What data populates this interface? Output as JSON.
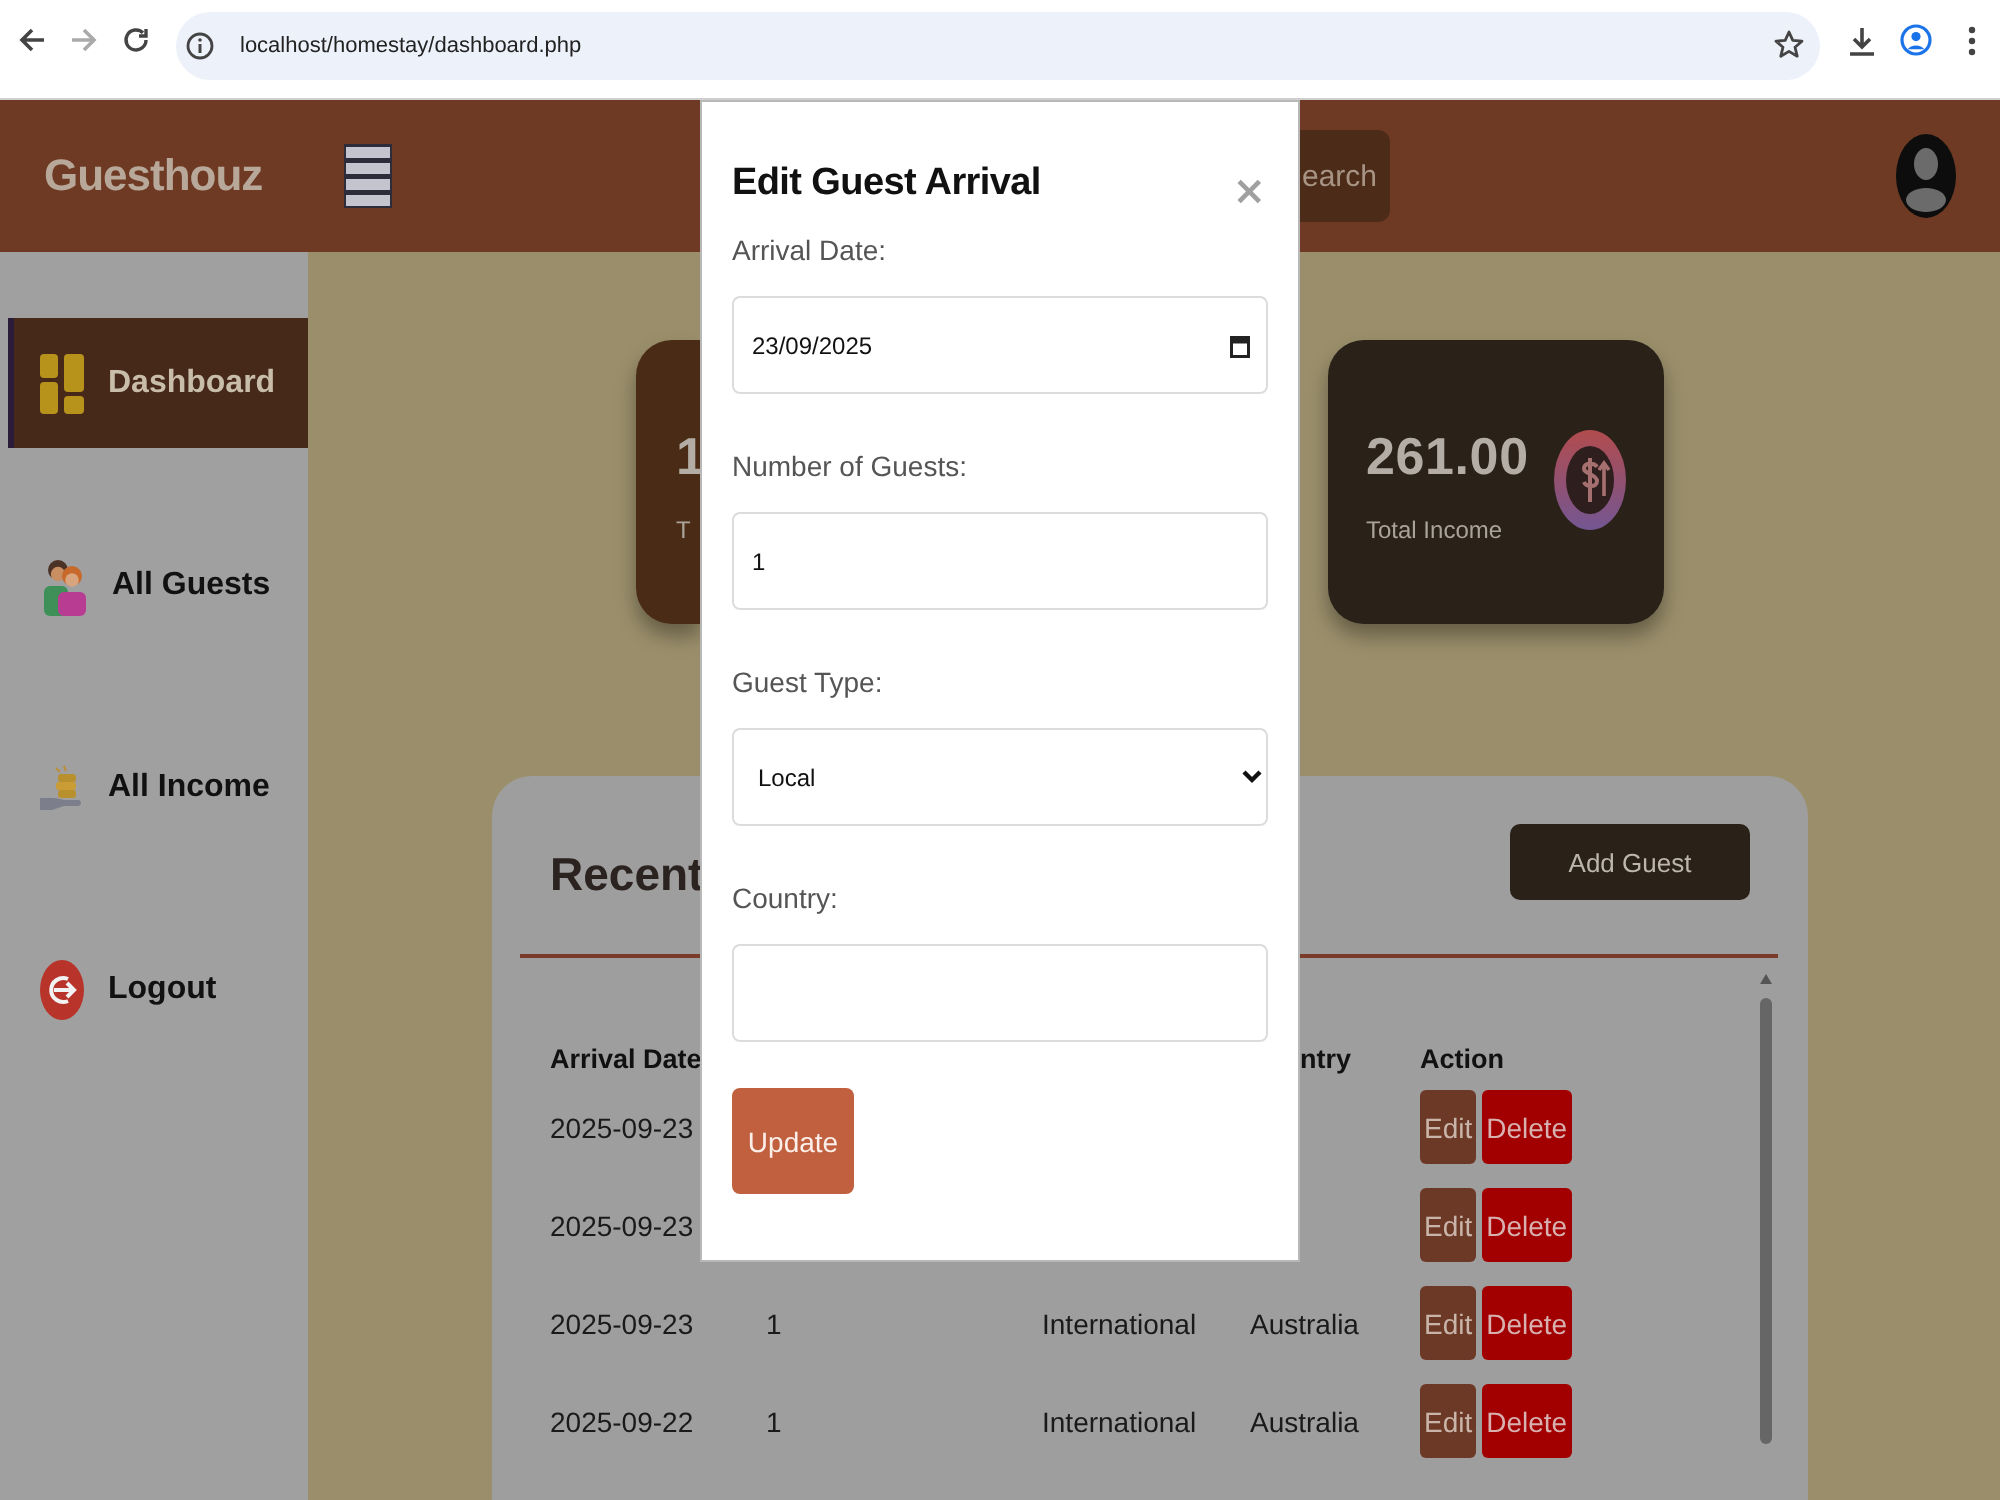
{
  "browser": {
    "url": "localhost/homestay/dashboard.php"
  },
  "header": {
    "logo": "Guesthouz",
    "search_button": "earch"
  },
  "sidebar": {
    "items": [
      {
        "label": "Dashboard",
        "selected": true
      },
      {
        "label": "All Guests",
        "selected": false
      },
      {
        "label": "All Income",
        "selected": false
      },
      {
        "label": "Logout",
        "selected": false
      }
    ]
  },
  "cards": [
    {
      "value": "1",
      "label": "T"
    },
    {
      "value": "261.00",
      "label": "Total Income"
    }
  ],
  "recent": {
    "title": "Recent",
    "add_button": "Add Guest",
    "table": {
      "columns": [
        "Arrival Date",
        null,
        null,
        "ntry",
        "Action"
      ],
      "rows": [
        {
          "cells": [
            "2025-09-23",
            null,
            null,
            null
          ],
          "actions": [
            "Edit",
            "Delete"
          ]
        },
        {
          "cells": [
            "2025-09-23",
            null,
            null,
            null
          ],
          "actions": [
            "Edit",
            "Delete"
          ]
        },
        {
          "cells": [
            "2025-09-23",
            "1",
            "International",
            "Australia"
          ],
          "actions": [
            "Edit",
            "Delete"
          ]
        },
        {
          "cells": [
            "2025-09-22",
            "1",
            "International",
            "Australia"
          ],
          "actions": [
            "Edit",
            "Delete"
          ]
        }
      ]
    }
  },
  "modal": {
    "title": "Edit Guest Arrival",
    "close": "×",
    "fields": [
      {
        "kind": "date",
        "label": "Arrival Date:",
        "value": "23/09/2025"
      },
      {
        "kind": "text",
        "label": "Number of Guests:",
        "value": "1"
      },
      {
        "kind": "select",
        "label": "Guest Type:",
        "value": "Local"
      },
      {
        "kind": "text",
        "label": "Country:"
      }
    ],
    "submit": "Update"
  }
}
